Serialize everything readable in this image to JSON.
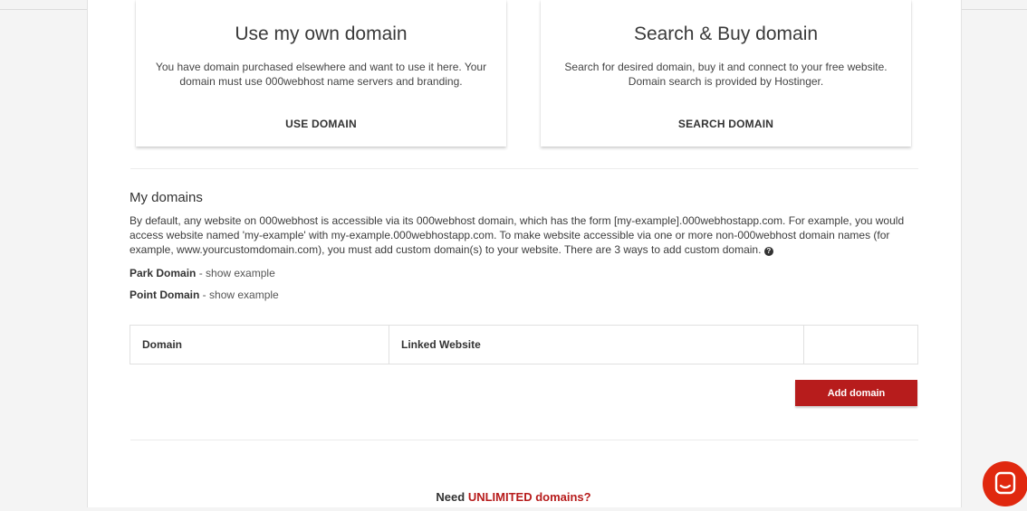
{
  "colors": {
    "accent": "#b71c1c",
    "chat": "#e0280f"
  },
  "cards": [
    {
      "title": "Use my own domain",
      "description": "You have domain purchased elsewhere and want to use it here. Your domain must use 000webhost name servers and branding.",
      "button": "USE DOMAIN"
    },
    {
      "title": "Search & Buy domain",
      "description": "Search for desired domain, buy it and connect to your free website. Domain search is provided by Hostinger.",
      "button": "SEARCH DOMAIN"
    }
  ],
  "my_domains": {
    "title": "My domains",
    "description": "By default, any website on 000webhost is accessible via its 000webhost domain, which has the form [my-example].000webhostapp.com. For example, you would access website named 'my-example' with my-example.000webhostapp.com. To make website accessible via one or more non-000webhost domain names (for example, www.yourcustomdomain.com), you must add custom domain(s) to your website. There are 3 ways to add custom domain.",
    "help_icon": "question-circle-icon",
    "methods": [
      {
        "name": "Park Domain",
        "separator": " - ",
        "link": "show example"
      },
      {
        "name": "Point Domain",
        "separator": " - ",
        "link": "show example"
      }
    ],
    "table": {
      "headers": [
        "Domain",
        "Linked Website",
        ""
      ]
    },
    "add_button": "Add domain"
  },
  "promo": {
    "prefix": "Need ",
    "highlight": "UNLIMITED domains?"
  },
  "chat_icon": "chat-bubble-icon"
}
